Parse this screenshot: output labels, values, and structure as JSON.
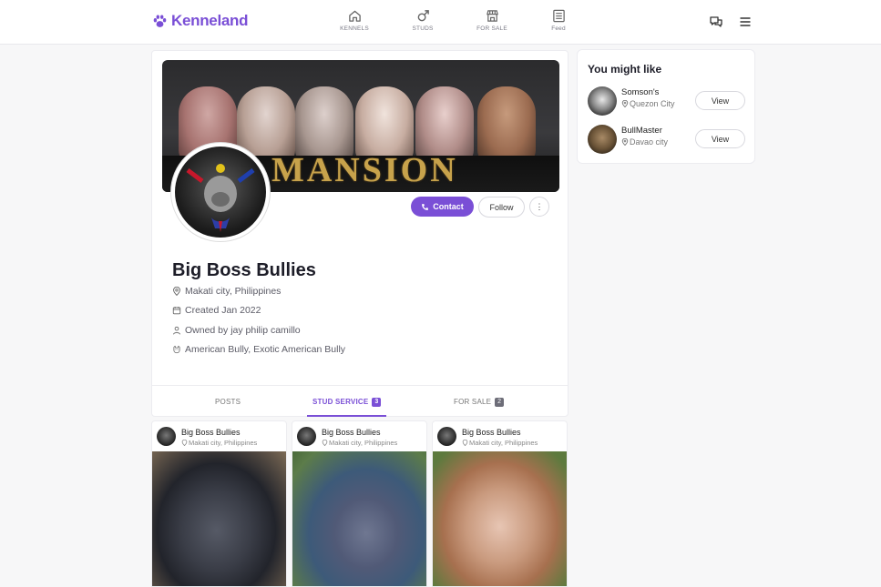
{
  "brand": {
    "name": "Kenneland",
    "color": "#7a4fd6"
  },
  "nav": [
    {
      "label": "KENNELS",
      "icon": "home-icon"
    },
    {
      "label": "STUDS",
      "icon": "male-icon"
    },
    {
      "label": "FOR SALE",
      "icon": "store-icon"
    },
    {
      "label": "Feed",
      "icon": "newspaper-icon"
    }
  ],
  "header_actions": {
    "chat_icon": "chat-icon",
    "menu_icon": "menu-icon"
  },
  "profile": {
    "cover_text": "MANSION",
    "name": "Big Boss Bullies",
    "location": "Makati city, Philippines",
    "created": "Created Jan 2022",
    "owner": "Owned by jay philip camillo",
    "breeds": "American Bully, Exotic American Bully",
    "contact_label": "Contact",
    "follow_label": "Follow",
    "more_label": "⋮"
  },
  "tabs": [
    {
      "label": "POSTS",
      "count": ""
    },
    {
      "label": "STUD SERVICE",
      "count": "3",
      "active": true
    },
    {
      "label": "FOR SALE",
      "count": "2"
    }
  ],
  "stud_cards": [
    {
      "name": "Big Boss Bullies",
      "location": "Makati city, Philippines"
    },
    {
      "name": "Big Boss Bullies",
      "location": "Makati city, Philippines"
    },
    {
      "name": "Big Boss Bullies",
      "location": "Makati city, Philippines"
    }
  ],
  "sidebar": {
    "title": "You might like",
    "items": [
      {
        "name": "Somson's",
        "city": "Quezon City",
        "button": "View"
      },
      {
        "name": "BullMaster",
        "city": "Davao city",
        "button": "View"
      }
    ]
  }
}
